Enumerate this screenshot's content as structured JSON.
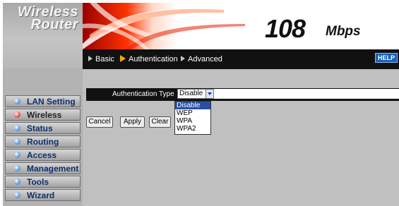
{
  "logo": {
    "line1": "Wireless",
    "line2": "Router"
  },
  "banner": {
    "speed": "108",
    "unit": "Mbps"
  },
  "nav": {
    "items": [
      "Basic",
      "Authentication",
      "Advanced"
    ],
    "selected": "Authentication",
    "help_label": "HELP"
  },
  "sidebar": {
    "items": [
      {
        "label": "LAN Setting",
        "active": false
      },
      {
        "label": "Wireless",
        "active": true
      },
      {
        "label": "Status",
        "active": false
      },
      {
        "label": "Routing",
        "active": false
      },
      {
        "label": "Access",
        "active": false
      },
      {
        "label": "Management",
        "active": false
      },
      {
        "label": "Tools",
        "active": false
      },
      {
        "label": "Wizard",
        "active": false
      }
    ]
  },
  "auth": {
    "label": "Authentication Type",
    "selected": "Disable",
    "options": [
      "Disable",
      "WEP",
      "WPA",
      "WPA2"
    ]
  },
  "buttons": {
    "cancel": "Cancel",
    "apply": "Apply",
    "clear": "Clear"
  },
  "colors": {
    "accent_red": "#e81f00",
    "nav_bg": "#111111",
    "help_blue": "#1a5fb8",
    "selection_blue": "#2a4ea2"
  }
}
